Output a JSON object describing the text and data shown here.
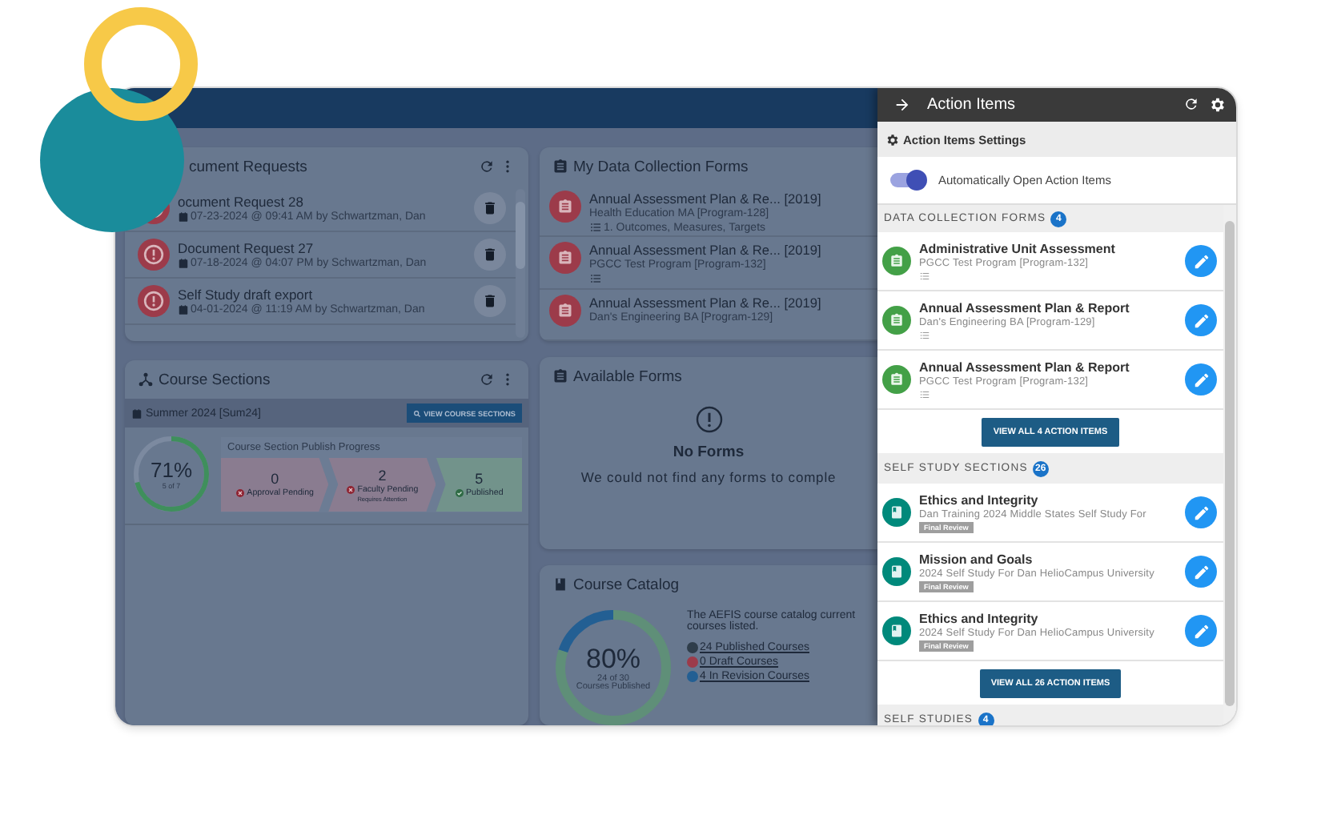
{
  "document_requests": {
    "title": "cument Requests",
    "items": [
      {
        "title": "ocument Request 28",
        "meta": "07-23-2024 @ 09:41 AM by Schwartzman, Dan"
      },
      {
        "title": "Document Request 27",
        "meta": "07-18-2024 @ 04:07 PM by Schwartzman, Dan"
      },
      {
        "title": "Self Study draft export",
        "meta": "04-01-2024 @ 11:19 AM by Schwartzman, Dan"
      }
    ]
  },
  "course_sections": {
    "title": "Course Sections",
    "term": "Summer 2024 [Sum24]",
    "button": "VIEW COURSE SECTIONS",
    "progress": {
      "level": 0.71,
      "percent": "71%",
      "caption": "5 of 7"
    },
    "publish_title": "Course Section Publish Progress",
    "stages": [
      {
        "kind": "pending",
        "count": "0",
        "label": "Approval Pending"
      },
      {
        "kind": "pending",
        "count": "2",
        "label": "Faculty Pending",
        "note": "Requires Attention"
      },
      {
        "kind": "done",
        "count": "5",
        "label": "Published"
      }
    ]
  },
  "my_forms": {
    "title": "My Data Collection Forms",
    "items": [
      {
        "title": "Annual Assessment Plan & Re... [2019]",
        "program": "Health Education MA [Program-128]",
        "list_icon": true,
        "step": "1. Outcomes, Measures, Targets"
      },
      {
        "title": "Annual Assessment Plan & Re... [2019]",
        "program": "PGCC Test Program [Program-132]",
        "list_icon": true
      },
      {
        "title": "Annual Assessment Plan & Re... [2019]",
        "program": "Dan's Engineering BA [Program-129]",
        "list_icon": false
      }
    ]
  },
  "available_forms": {
    "title": "Available Forms",
    "empty_title": "No Forms",
    "empty_text": "We could not find any forms to comple"
  },
  "course_catalog": {
    "title": "Course Catalog",
    "level": 0.8,
    "percent": "80%",
    "caption_1": "24 of 30",
    "caption_2": "Courses Published",
    "text_1": "The AEFIS course catalog current",
    "text_2": "courses listed.",
    "links": [
      {
        "label": "24 Published Courses",
        "color": "#2f3d4a"
      },
      {
        "label": "0 Draft Courses",
        "color": "#9c3b4a"
      },
      {
        "label": "4 In Revision Courses",
        "color": "#235f93"
      }
    ]
  },
  "action_panel": {
    "title": "Action Items",
    "settings_title": "Action Items Settings",
    "auto_open": {
      "label": "Automatically Open Action Items",
      "on": true
    },
    "sections": [
      {
        "title": "DATA COLLECTION FORMS",
        "count": "4",
        "kind": "form",
        "button": "VIEW ALL 4 ACTION ITEMS",
        "items": [
          {
            "title": "Administrative Unit Assessment",
            "subtitle": "PGCC Test Program [Program-132]"
          },
          {
            "title": "Annual Assessment Plan & Report",
            "subtitle": "Dan's Engineering BA [Program-129]"
          },
          {
            "title": "Annual Assessment Plan & Report",
            "subtitle": "PGCC Test Program [Program-132]"
          }
        ]
      },
      {
        "title": "SELF STUDY SECTIONS",
        "count": "26",
        "kind": "self_study",
        "button": "VIEW ALL 26 ACTION ITEMS",
        "items": [
          {
            "title": "Ethics and Integrity",
            "subtitle": "Dan Training 2024 Middle States Self Study For",
            "tag": "Final Review"
          },
          {
            "title": "Mission and Goals",
            "subtitle": "2024 Self Study For Dan HelioCampus University",
            "tag": "Final Review"
          },
          {
            "title": "Ethics and Integrity",
            "subtitle": "2024 Self Study For Dan HelioCampus University",
            "tag": "Final Review"
          }
        ]
      },
      {
        "title": "SELF STUDIES",
        "count": "4"
      }
    ]
  }
}
